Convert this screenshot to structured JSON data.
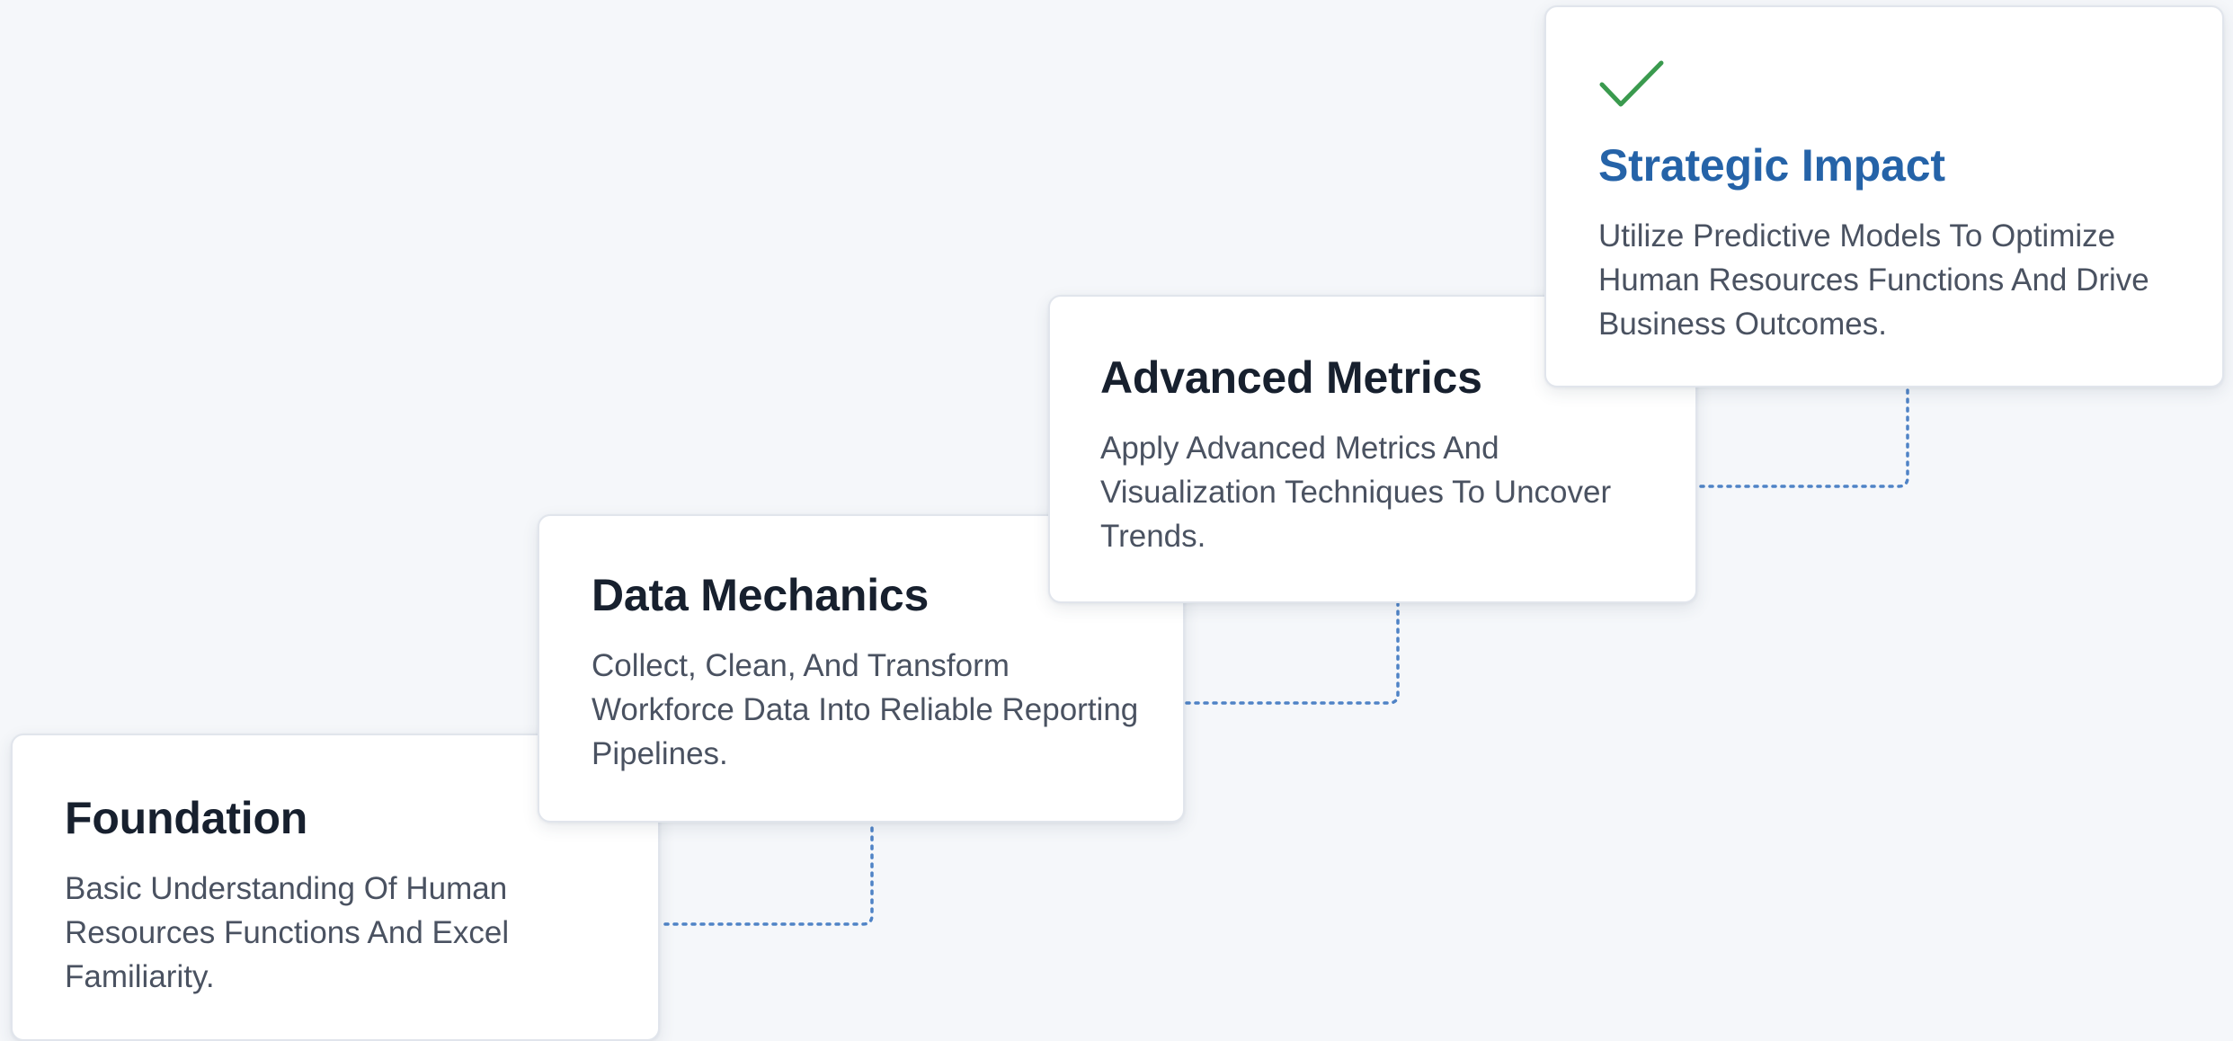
{
  "steps": [
    {
      "title": "Foundation",
      "description": "Basic Understanding Of Human Resources Functions And Excel Familiarity."
    },
    {
      "title": "Data Mechanics",
      "description": "Collect, Clean, And Transform Workforce Data Into Reliable Reporting Pipelines."
    },
    {
      "title": "Advanced Metrics",
      "description": "Apply Advanced Metrics And Visualization Techniques To Uncover Trends."
    },
    {
      "title": "Strategic Impact",
      "description": "Utilize Predictive Models To Optimize Human Resources Functions And Drive Business Outcomes.",
      "icon": "checkmark-icon"
    }
  ],
  "colors": {
    "background": "#f5f7fa",
    "title": "#17202e",
    "description": "#4a5261",
    "highlight_title": "#2563a8",
    "checkmark": "#3a9a4e",
    "connector": "#4f83c6"
  }
}
